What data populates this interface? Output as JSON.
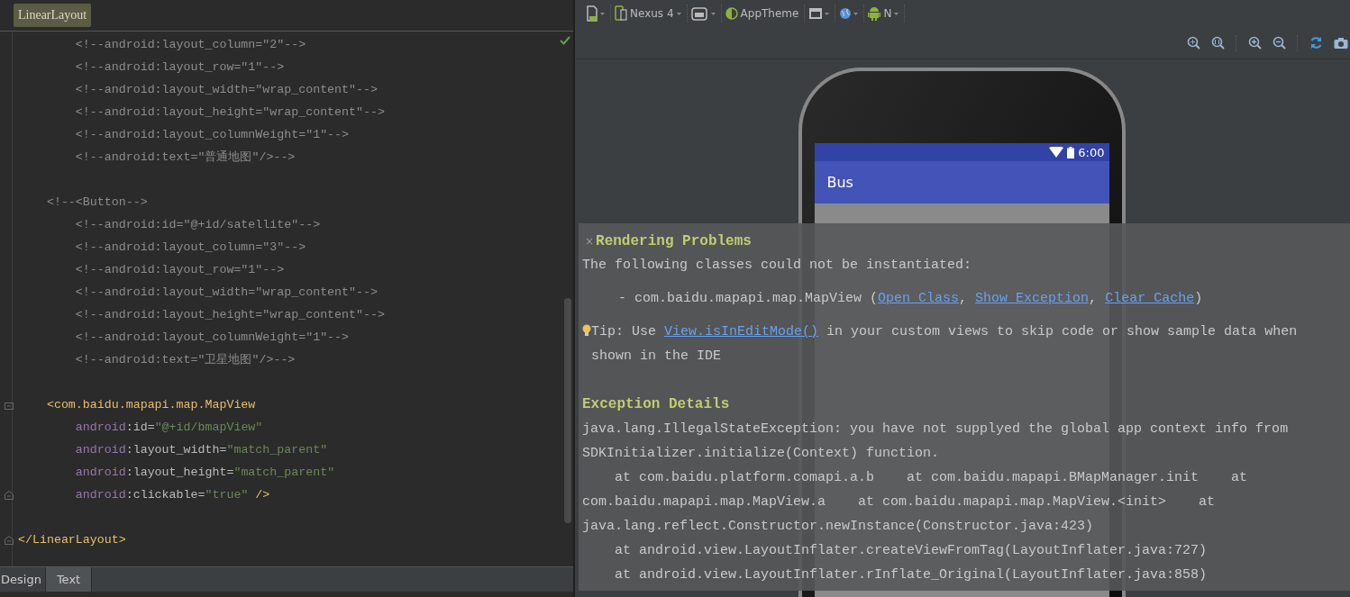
{
  "editor": {
    "breadcrumb": "LinearLayout",
    "blocks": [
      {
        "lines": [
          {
            "segments": [
              {
                "kind": "comment",
                "text": "        <!--android:layout_column=\"2\"-->"
              }
            ]
          },
          {
            "segments": [
              {
                "kind": "comment",
                "text": "        <!--android:layout_row=\"1\"-->"
              }
            ]
          },
          {
            "segments": [
              {
                "kind": "comment",
                "text": "        <!--android:layout_width=\"wrap_content\"-->"
              }
            ]
          },
          {
            "segments": [
              {
                "kind": "comment",
                "text": "        <!--android:layout_height=\"wrap_content\"-->"
              }
            ]
          },
          {
            "segments": [
              {
                "kind": "comment",
                "text": "        <!--android:layout_columnWeight=\"1\"-->"
              }
            ]
          },
          {
            "segments": [
              {
                "kind": "comment",
                "text": "        <!--android:text=\"普通地图\"/>-->"
              }
            ]
          }
        ]
      },
      {
        "lines": [
          {
            "segments": [
              {
                "kind": "comment",
                "text": "    <!--<Button-->"
              }
            ]
          },
          {
            "segments": [
              {
                "kind": "comment",
                "text": "        <!--android:id=\"@+id/satellite\"-->"
              }
            ]
          },
          {
            "segments": [
              {
                "kind": "comment",
                "text": "        <!--android:layout_column=\"3\"-->"
              }
            ]
          },
          {
            "segments": [
              {
                "kind": "comment",
                "text": "        <!--android:layout_row=\"1\"-->"
              }
            ]
          },
          {
            "segments": [
              {
                "kind": "comment",
                "text": "        <!--android:layout_width=\"wrap_content\"-->"
              }
            ]
          },
          {
            "segments": [
              {
                "kind": "comment",
                "text": "        <!--android:layout_height=\"wrap_content\"-->"
              }
            ]
          },
          {
            "segments": [
              {
                "kind": "comment",
                "text": "        <!--android:layout_columnWeight=\"1\"-->"
              }
            ]
          },
          {
            "segments": [
              {
                "kind": "comment",
                "text": "        <!--android:text=\"卫星地图\"/>-->"
              }
            ]
          }
        ]
      },
      {
        "lines": [
          {
            "fold_start": true,
            "segments": [
              {
                "kind": "tag",
                "text": "    <com.baidu.mapapi.map.MapView"
              }
            ]
          },
          {
            "segments": [
              {
                "kind": "ns",
                "text": "        android"
              },
              {
                "kind": "attr",
                "text": ":id="
              },
              {
                "kind": "value",
                "text": "\"@+id/bmapView\""
              }
            ]
          },
          {
            "segments": [
              {
                "kind": "ns",
                "text": "        android"
              },
              {
                "kind": "attr",
                "text": ":layout_width="
              },
              {
                "kind": "value",
                "text": "\"match_parent\""
              }
            ]
          },
          {
            "segments": [
              {
                "kind": "ns",
                "text": "        android"
              },
              {
                "kind": "attr",
                "text": ":layout_height="
              },
              {
                "kind": "value",
                "text": "\"match_parent\""
              }
            ]
          },
          {
            "fold_end": true,
            "segments": [
              {
                "kind": "ns",
                "text": "        android"
              },
              {
                "kind": "attr",
                "text": ":clickable="
              },
              {
                "kind": "value",
                "text": "\"true\""
              },
              {
                "kind": "tag",
                "text": " />"
              }
            ]
          }
        ]
      },
      {
        "lines": [
          {
            "fold_end": true,
            "segments": [
              {
                "kind": "tag",
                "text": "</LinearLayout>"
              }
            ]
          }
        ]
      }
    ]
  },
  "bottom_tabs": [
    {
      "label": "Design",
      "selected": false
    },
    {
      "label": "Text",
      "selected": true
    }
  ],
  "toolbar": {
    "device": "Nexus 4",
    "theme": "AppTheme",
    "api": "N"
  },
  "preview": {
    "time": "6:00",
    "app_title": "Bus"
  },
  "rendering_problems": {
    "close": "×",
    "title": "Rendering Problems",
    "paragraphs": [
      {
        "kind": "plain",
        "parts": [
          {
            "kind": "text",
            "text": "The following classes could not be instantiated:"
          }
        ]
      },
      {
        "kind": "indent",
        "parts": [
          {
            "kind": "text",
            "text": "-  com.baidu.mapapi.map.MapView ("
          },
          {
            "kind": "link",
            "text": "Open Class"
          },
          {
            "kind": "text",
            "text": ", "
          },
          {
            "kind": "link",
            "text": "Show Exception"
          },
          {
            "kind": "text",
            "text": ", "
          },
          {
            "kind": "link",
            "text": "Clear Cache"
          },
          {
            "kind": "text",
            "text": ")"
          }
        ]
      },
      {
        "kind": "tip",
        "parts": [
          {
            "kind": "text",
            "text": "Tip: Use "
          },
          {
            "kind": "link",
            "text": "View.isInEditMode()"
          },
          {
            "kind": "text",
            "text": " in your custom views to skip code or show sample data when shown in the IDE"
          }
        ]
      }
    ],
    "exception_title": "Exception Details",
    "exception_lines": [
      "java.lang.IllegalStateException: you have not supplyed the global app context info from",
      "SDKInitializer.initialize(Context) function.",
      "    at com.baidu.platform.comapi.a.b    at com.baidu.mapapi.BMapManager.init    at",
      "com.baidu.mapapi.map.MapView.a    at com.baidu.mapapi.map.MapView.<init>    at",
      "java.lang.reflect.Constructor.newInstance(Constructor.java:423)",
      "    at android.view.LayoutInflater.createViewFromTag(LayoutInflater.java:727)",
      "    at android.view.LayoutInflater.rInflate_Original(LayoutInflater.java:858)"
    ]
  }
}
